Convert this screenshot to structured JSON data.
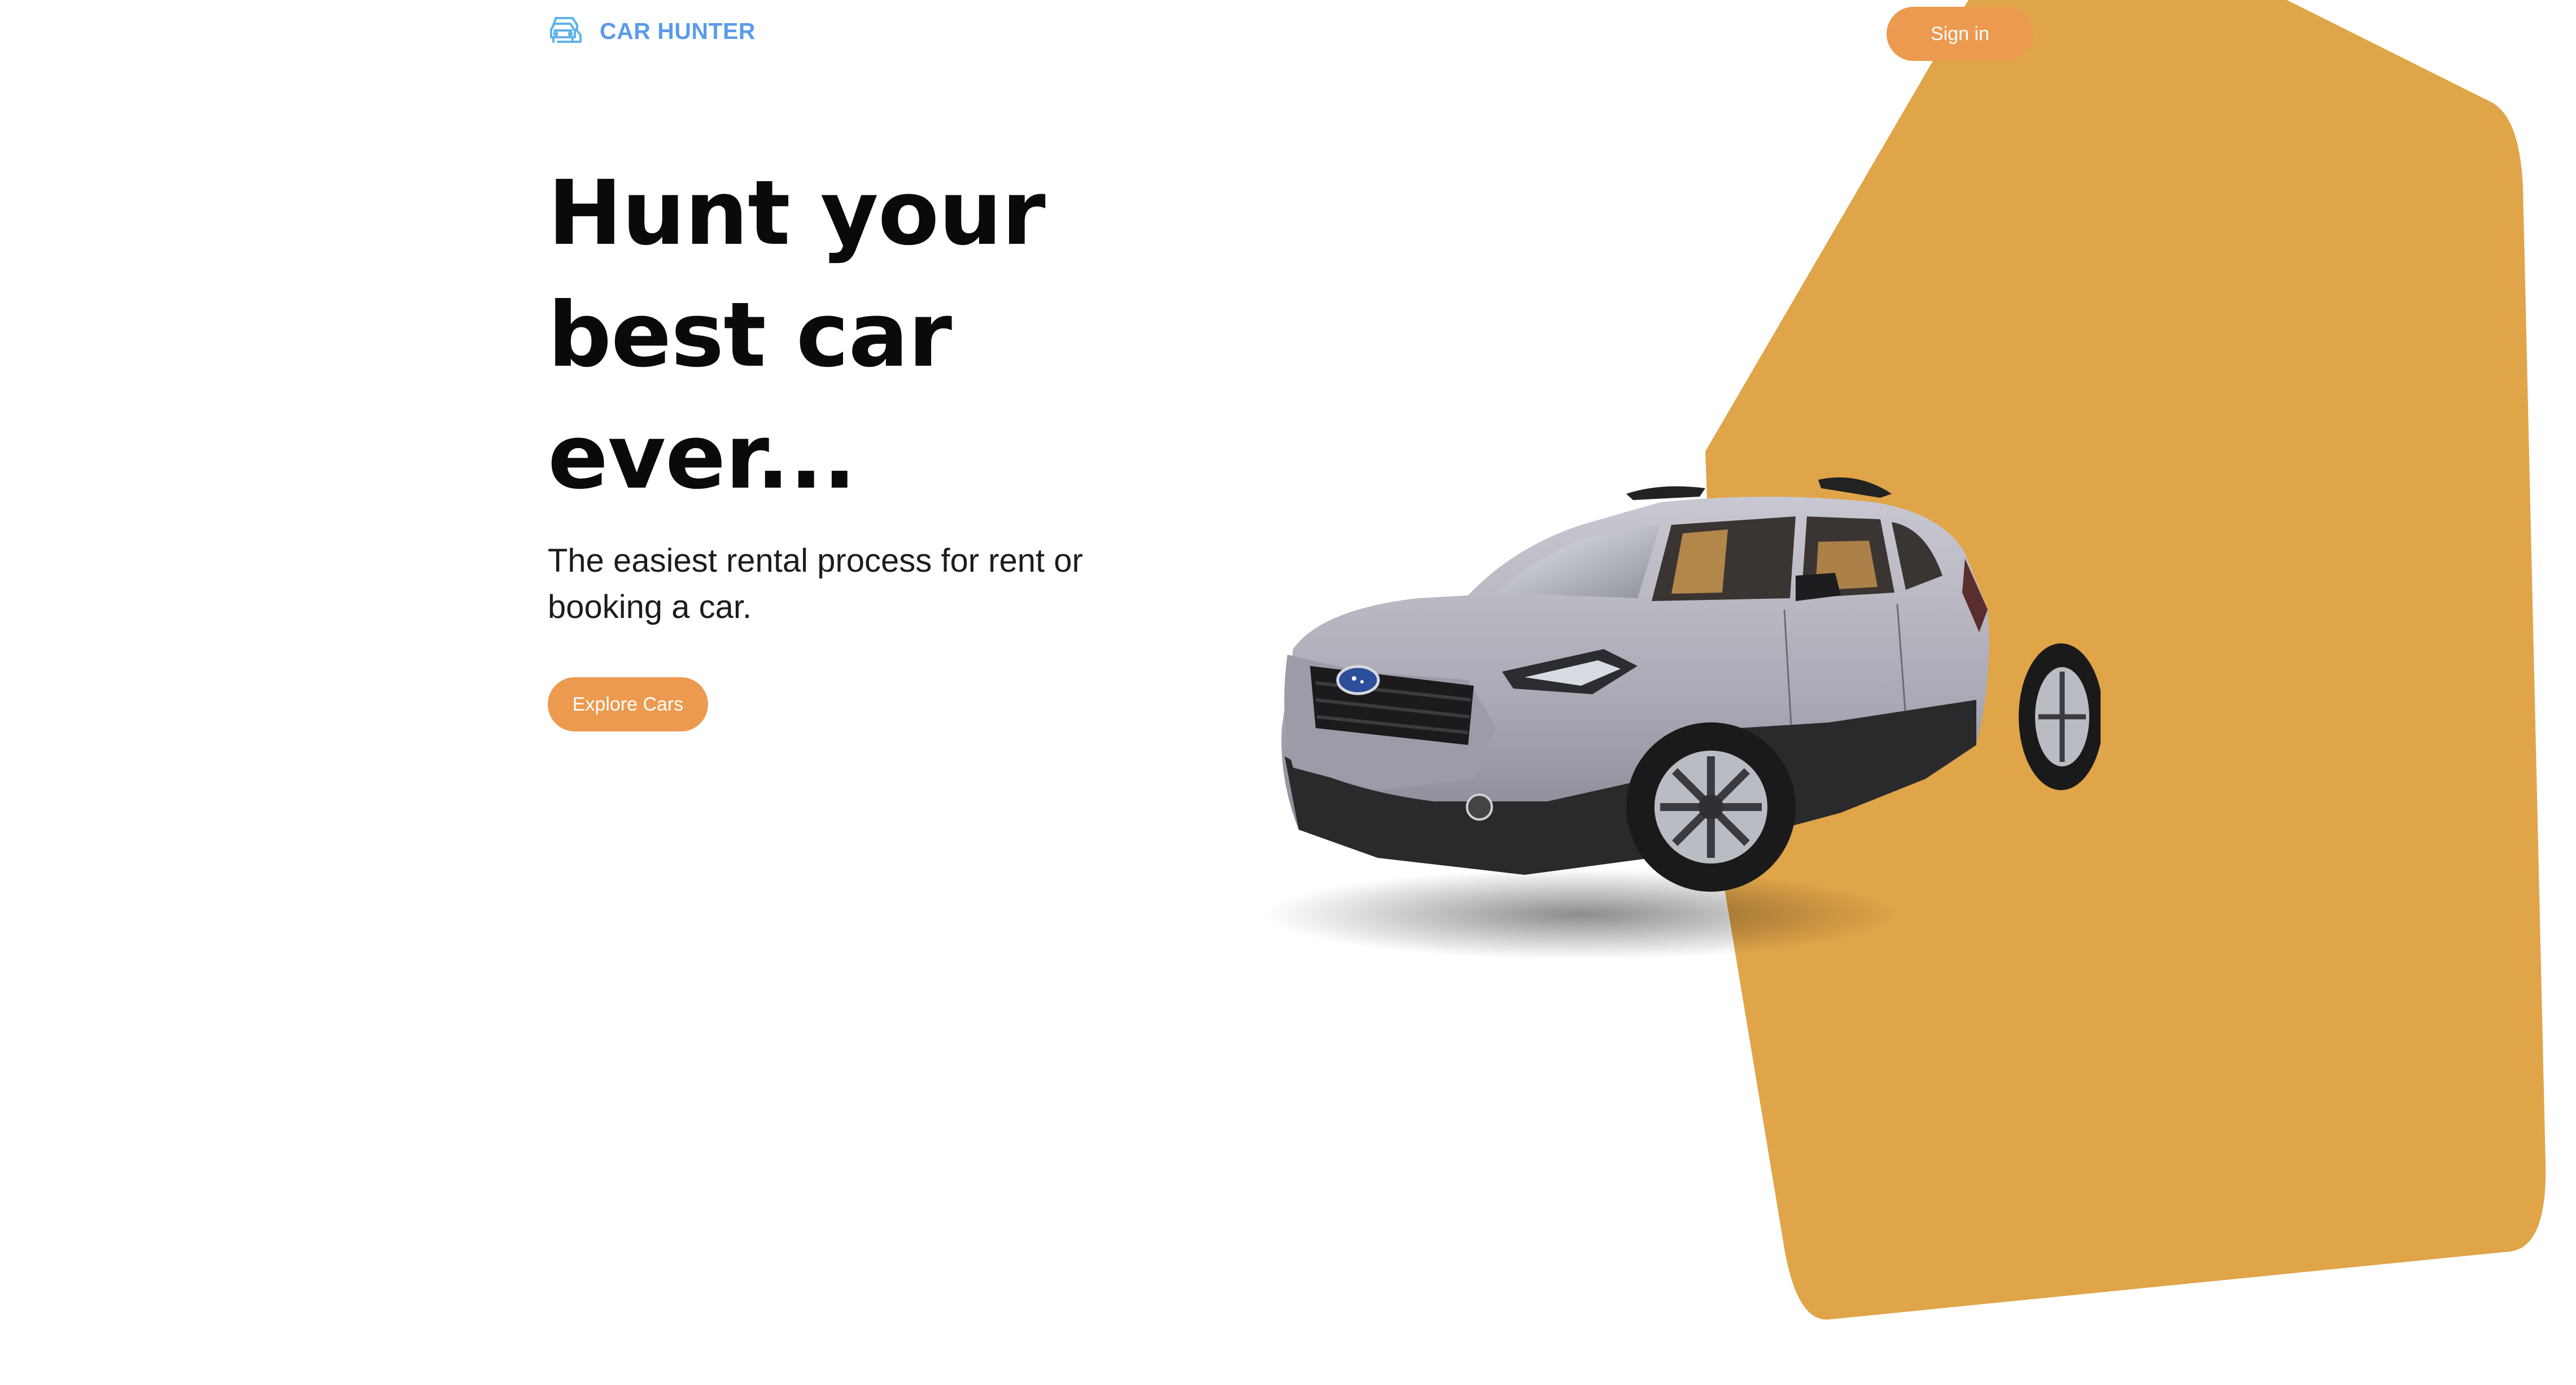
{
  "brand": {
    "name": "CAR HUNTER",
    "icon": "cars-icon",
    "color": "#5b9bea"
  },
  "nav": {
    "signin_label": "Sign in"
  },
  "hero": {
    "title_line1": "Hunt your",
    "title_line2": "best car",
    "title_line3": "ever...",
    "subtitle_line1": "The easiest rental process for rent or",
    "subtitle_line2": "booking a car.",
    "cta_label": "Explore Cars"
  },
  "colors": {
    "accent": "#ec9a4f",
    "blob": "#e0a449",
    "text": "#0a0a0a"
  },
  "image": {
    "subject": "silver-suv-car"
  }
}
